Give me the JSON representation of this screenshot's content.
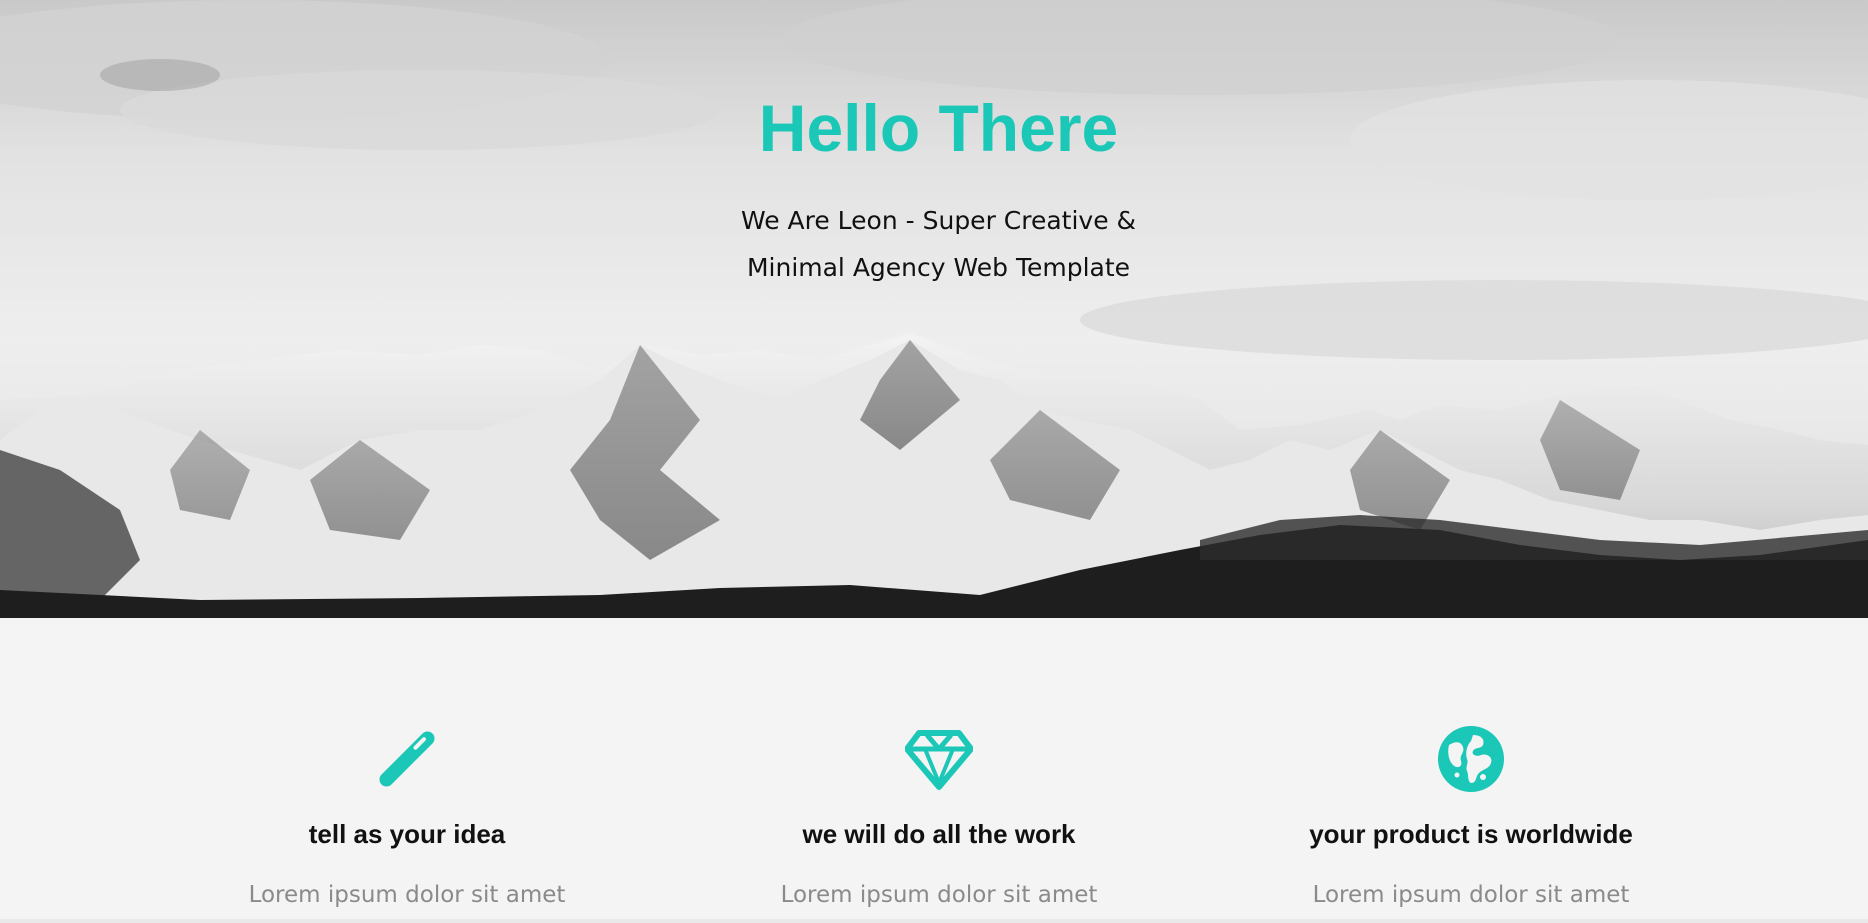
{
  "colors": {
    "accent": "#1bc7b6",
    "heading_text": "#111111",
    "body_text": "#8a8a8a",
    "section_bg": "#f4f4f4"
  },
  "hero": {
    "title": "Hello There",
    "subtitle_line1": "We Are Leon - Super Creative &",
    "subtitle_line2": "Minimal Agency Web Template",
    "background": "grayscale-snowy-mountain-range-photo"
  },
  "features": [
    {
      "icon": "pencil-icon",
      "title": "tell as your idea",
      "text": "Lorem ipsum dolor sit amet"
    },
    {
      "icon": "diamond-icon",
      "title": "we will do all the work",
      "text": "Lorem ipsum dolor sit amet"
    },
    {
      "icon": "globe-icon",
      "title": "your product is worldwide",
      "text": "Lorem ipsum dolor sit amet"
    }
  ]
}
